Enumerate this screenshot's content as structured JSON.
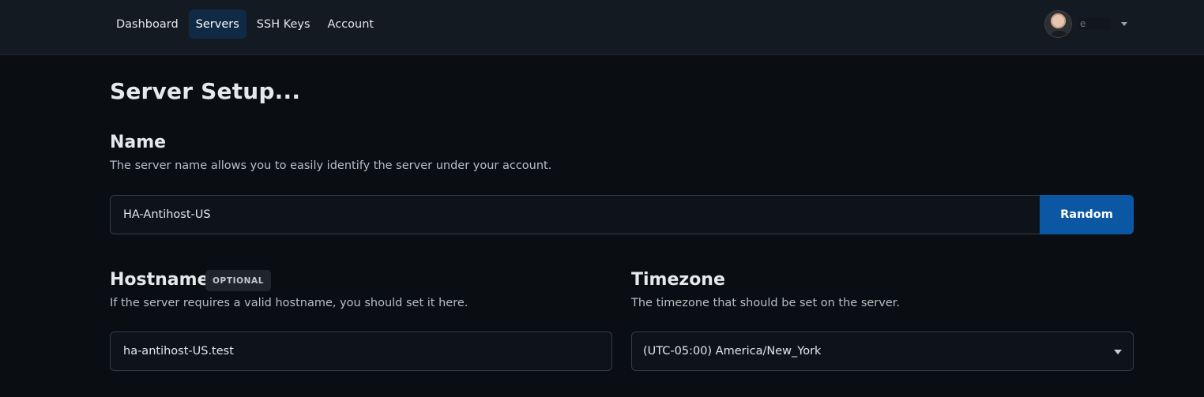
{
  "nav": {
    "items": [
      {
        "label": "Dashboard",
        "active": false
      },
      {
        "label": "Servers",
        "active": true
      },
      {
        "label": "SSH Keys",
        "active": false
      },
      {
        "label": "Account",
        "active": false
      }
    ]
  },
  "user": {
    "name": "e"
  },
  "page": {
    "title": "Server Setup..."
  },
  "name_section": {
    "title": "Name",
    "description": "The server name allows you to easily identify the server under your account.",
    "value": "HA-Antihost-US",
    "random_label": "Random"
  },
  "hostname_section": {
    "title": "Hostname",
    "badge": "OPTIONAL",
    "description": "If the server requires a valid hostname, you should set it here.",
    "value": "ha-antihost-US.test"
  },
  "timezone_section": {
    "title": "Timezone",
    "description": "The timezone that should be set on the server.",
    "selected": "(UTC-05:00) America/New_York"
  },
  "colors": {
    "background": "#0a0e13",
    "topbar": "#141a22",
    "accent": "#0b57a4",
    "active_nav": "#0f2a44"
  }
}
